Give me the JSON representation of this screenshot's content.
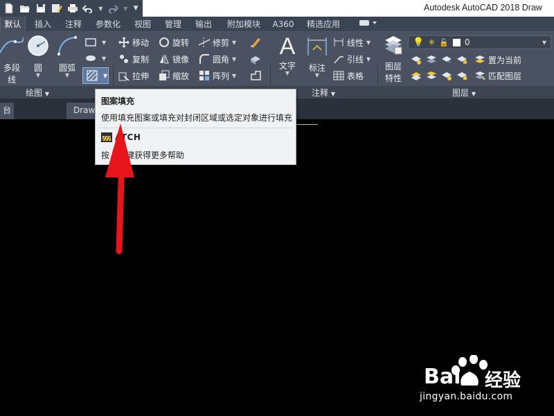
{
  "app": {
    "title": "Autodesk AutoCAD 2018   Draw"
  },
  "quick_access": {
    "icons": [
      "new-icon",
      "open-icon",
      "save-icon",
      "saveas-icon",
      "print-icon",
      "undo-icon",
      "redo-icon",
      "customize-icon"
    ]
  },
  "tabs": [
    {
      "label": "默认",
      "active": true
    },
    {
      "label": "插入"
    },
    {
      "label": "注释"
    },
    {
      "label": "参数化"
    },
    {
      "label": "视图"
    },
    {
      "label": "管理"
    },
    {
      "label": "输出"
    },
    {
      "label": "附加模块"
    },
    {
      "label": "A360"
    },
    {
      "label": "精选应用"
    }
  ],
  "ribbon": {
    "draw": {
      "polyline": "多段线",
      "circle": "圆",
      "arc": "圆弧",
      "panel": "绘图"
    },
    "modify": {
      "move": "移动",
      "rotate": "旋转",
      "trim": "修剪",
      "copy": "复制",
      "mirror": "镜像",
      "fillet": "圆角",
      "stretch": "拉伸",
      "scale": "缩放",
      "array": "阵列"
    },
    "annotation": {
      "text": "文字",
      "dimension": "标注",
      "linear": "线性",
      "leader": "引线",
      "table": "表格",
      "panel": "注释"
    },
    "layers": {
      "properties_line1": "图层",
      "properties_line2": "特性",
      "current_layer": "0",
      "make_current": "置为当前",
      "match_layer": "匹配图层",
      "panel": "图层"
    }
  },
  "doc_tabs": {
    "left": "台",
    "drawing": "Draw"
  },
  "tooltip": {
    "title": "图案填充",
    "description": "使用填充图案或填充对封闭区域或选定对象进行填充",
    "command": "HATCH",
    "help": "按 F1 键获得更多帮助",
    "help_visible_prefix": "按",
    "help_visible_suffix": "键获得更多帮助",
    "command_visible": "ATCH"
  },
  "watermark": {
    "brand": "Bai",
    "brand_cn": "经验",
    "url": "jingyan.baidu.com"
  },
  "colors": {
    "ribbon": "#4a5261",
    "tabbar": "#3b4453",
    "arrow": "#e8141c",
    "canvas": "#000000"
  }
}
